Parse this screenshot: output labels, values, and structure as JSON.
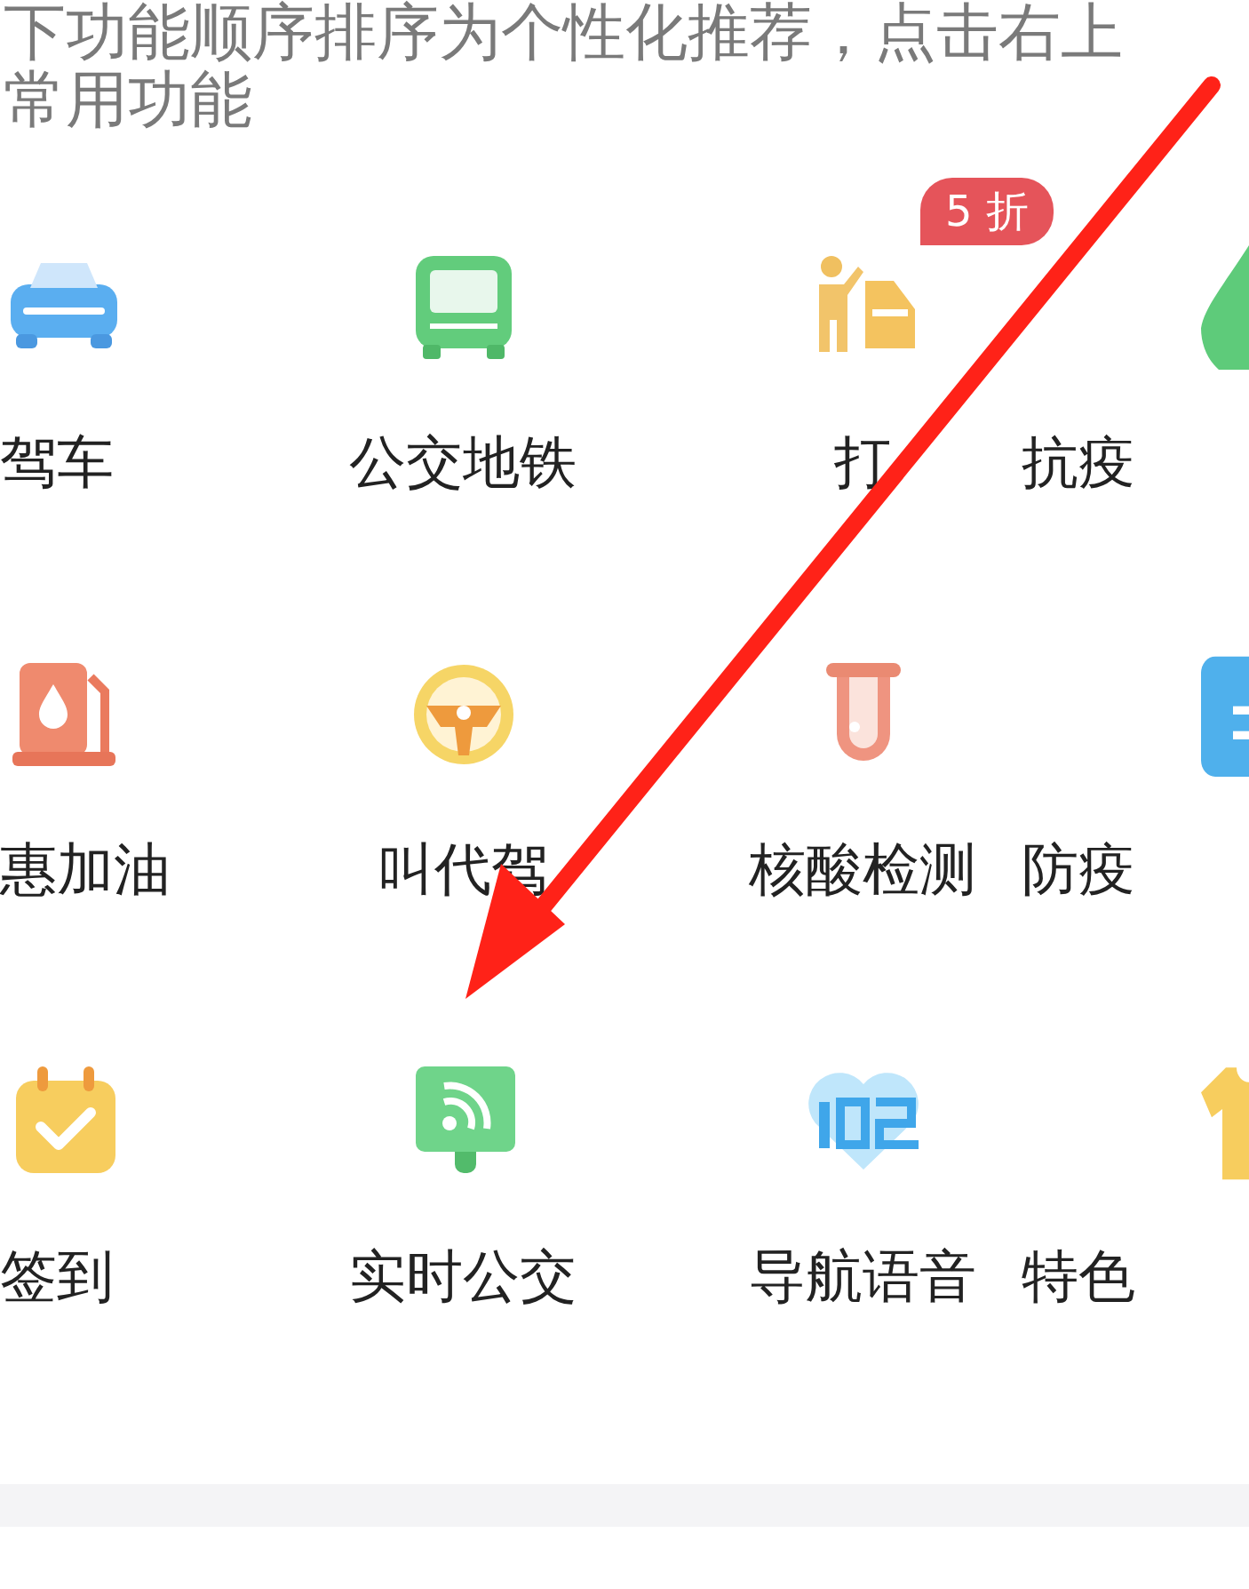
{
  "intro": [
    "下功能顺序排序为个性化推荐，点击右上",
    "常用功能"
  ],
  "rows": [
    [
      {
        "label": "驾车"
      },
      {
        "label": "公交地铁"
      },
      {
        "label": "打",
        "badge": "5 折"
      },
      {
        "label": "抗疫"
      }
    ],
    [
      {
        "label": "惠加油"
      },
      {
        "label": "叫代驾"
      },
      {
        "label": "核酸检测"
      },
      {
        "label": "防疫"
      }
    ],
    [
      {
        "label": "签到"
      },
      {
        "label": "实时公交"
      },
      {
        "label": "导航语音"
      },
      {
        "label": "特色"
      }
    ]
  ]
}
